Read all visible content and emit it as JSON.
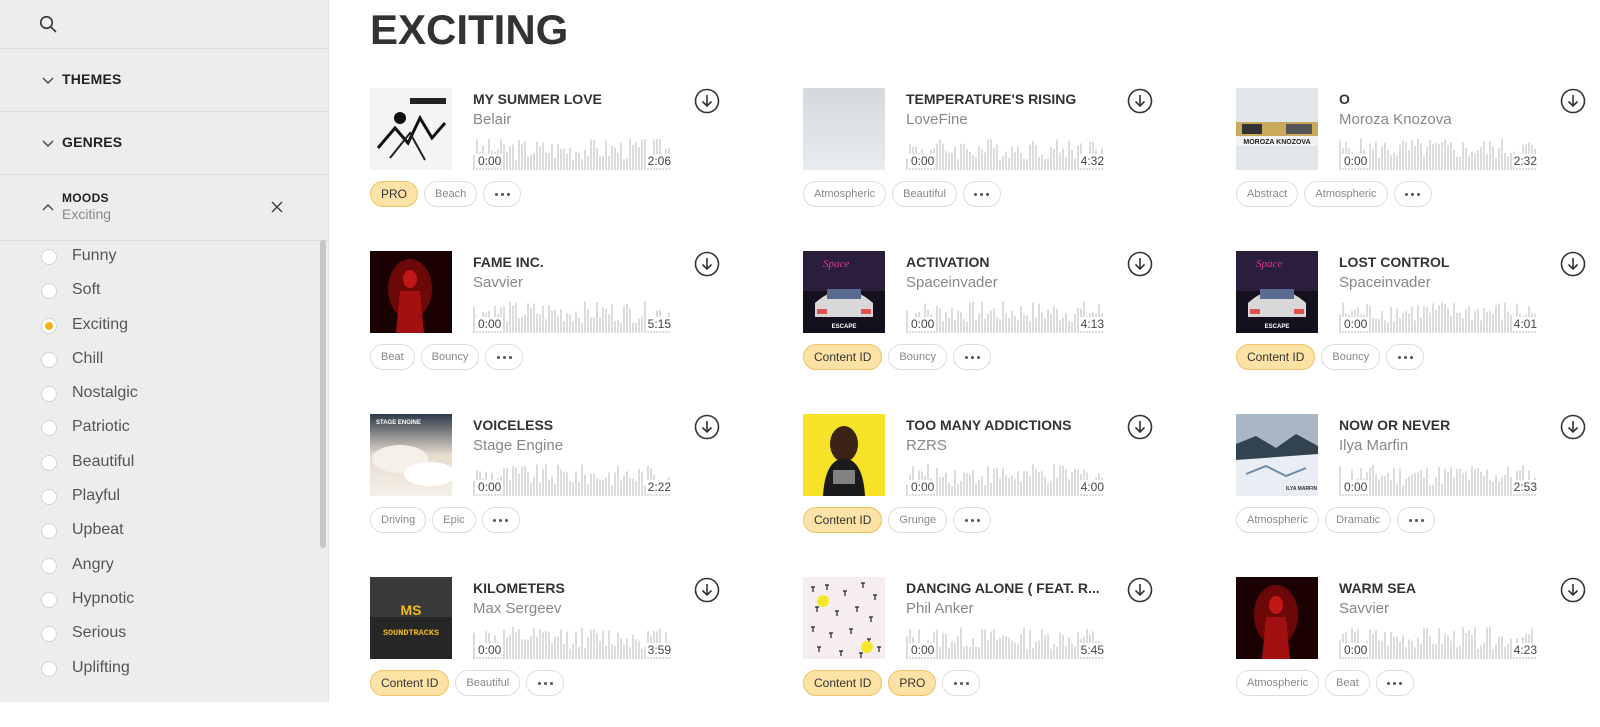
{
  "sidebar": {
    "search_icon": "search-icon",
    "sections": [
      {
        "label": "THEMES"
      },
      {
        "label": "GENRES"
      }
    ],
    "moods": {
      "label": "MOODS",
      "value": "Exciting",
      "items": [
        {
          "label": "Funny",
          "selected": false
        },
        {
          "label": "Soft",
          "selected": false
        },
        {
          "label": "Exciting",
          "selected": true
        },
        {
          "label": "Chill",
          "selected": false
        },
        {
          "label": "Nostalgic",
          "selected": false
        },
        {
          "label": "Patriotic",
          "selected": false
        },
        {
          "label": "Beautiful",
          "selected": false
        },
        {
          "label": "Playful",
          "selected": false
        },
        {
          "label": "Upbeat",
          "selected": false
        },
        {
          "label": "Angry",
          "selected": false
        },
        {
          "label": "Hypnotic",
          "selected": false
        },
        {
          "label": "Serious",
          "selected": false
        },
        {
          "label": "Uplifting",
          "selected": false
        }
      ]
    }
  },
  "main": {
    "title": "EXCITING",
    "tracks": [
      {
        "name": "MY SUMMER LOVE",
        "artist": "Belair",
        "start": "0:00",
        "duration": "2:06",
        "tags": [
          {
            "label": "PRO",
            "highlight": true
          },
          {
            "label": "Beach",
            "highlight": false
          }
        ],
        "cover": "sketch"
      },
      {
        "name": "TEMPERATURE'S RISING",
        "artist": "LoveFine",
        "start": "0:00",
        "duration": "4:32",
        "tags": [
          {
            "label": "Atmospheric",
            "highlight": false
          },
          {
            "label": "Beautiful",
            "highlight": false
          }
        ],
        "cover": "fog"
      },
      {
        "name": "O",
        "artist": "Moroza Knozova",
        "start": "0:00",
        "duration": "2:32",
        "tags": [
          {
            "label": "Abstract",
            "highlight": false
          },
          {
            "label": "Atmospheric",
            "highlight": false
          }
        ],
        "cover": "moroza",
        "cover_text": "MOROZA KNOZOVA"
      },
      {
        "name": "FAME INC.",
        "artist": "Savvier",
        "start": "0:00",
        "duration": "5:15",
        "tags": [
          {
            "label": "Beat",
            "highlight": false
          },
          {
            "label": "Bouncy",
            "highlight": false
          }
        ],
        "cover": "red"
      },
      {
        "name": "ACTIVATION",
        "artist": "Spaceinvader",
        "start": "0:00",
        "duration": "4:13",
        "tags": [
          {
            "label": "Content ID",
            "highlight": true
          },
          {
            "label": "Bouncy",
            "highlight": false
          }
        ],
        "cover": "car",
        "cover_text": "ESCAPE"
      },
      {
        "name": "LOST CONTROL",
        "artist": "Spaceinvader",
        "start": "0:00",
        "duration": "4:01",
        "tags": [
          {
            "label": "Content ID",
            "highlight": true
          },
          {
            "label": "Bouncy",
            "highlight": false
          }
        ],
        "cover": "car",
        "cover_text": "ESCAPE"
      },
      {
        "name": "VOICELESS",
        "artist": "Stage Engine",
        "start": "0:00",
        "duration": "2:22",
        "tags": [
          {
            "label": "Driving",
            "highlight": false
          },
          {
            "label": "Epic",
            "highlight": false
          }
        ],
        "cover": "sky",
        "cover_text": "STAGE ENGINE"
      },
      {
        "name": "TOO MANY ADDICTIONS",
        "artist": "RZRS",
        "start": "0:00",
        "duration": "4:00",
        "tags": [
          {
            "label": "Content ID",
            "highlight": true
          },
          {
            "label": "Grunge",
            "highlight": false
          }
        ],
        "cover": "yellow"
      },
      {
        "name": "NOW OR NEVER",
        "artist": "Ilya Marfin",
        "start": "0:00",
        "duration": "2:53",
        "tags": [
          {
            "label": "Atmospheric",
            "highlight": false
          },
          {
            "label": "Dramatic",
            "highlight": false
          }
        ],
        "cover": "glacier",
        "cover_text": "ILYA MARFIN"
      },
      {
        "name": "KILOMETERS",
        "artist": "Max Sergeev",
        "start": "0:00",
        "duration": "3:59",
        "tags": [
          {
            "label": "Content ID",
            "highlight": true
          },
          {
            "label": "Beautiful",
            "highlight": false
          }
        ],
        "cover": "ms",
        "cover_text": "SOUNDTRACKS"
      },
      {
        "name": "DANCING ALONE ( FEAT. R...",
        "artist": "Phil Anker",
        "start": "0:00",
        "duration": "5:45",
        "tags": [
          {
            "label": "Content ID",
            "highlight": true
          },
          {
            "label": "PRO",
            "highlight": true
          }
        ],
        "cover": "pattern"
      },
      {
        "name": "WARM SEA",
        "artist": "Savvier",
        "start": "0:00",
        "duration": "4:23",
        "tags": [
          {
            "label": "Atmospheric",
            "highlight": false
          },
          {
            "label": "Beat",
            "highlight": false
          }
        ],
        "cover": "red"
      }
    ]
  },
  "colors": {
    "accent": "#f5b21f",
    "tag_highlight_bg": "#fde2a6",
    "sidebar_bg": "#ededed"
  }
}
